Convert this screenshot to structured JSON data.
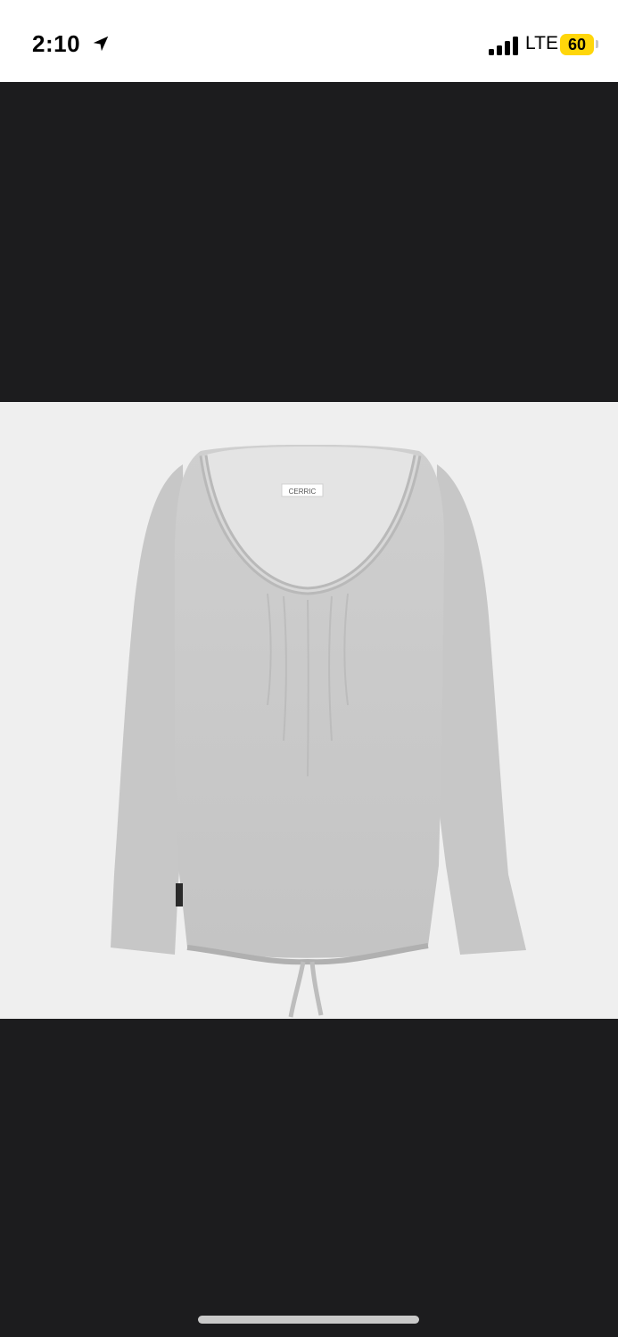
{
  "status_bar": {
    "time": "2:10",
    "location_icon": "location-arrow-icon",
    "signal_icon": "cellular-signal-icon",
    "network": "LTE",
    "battery_level": "60",
    "battery_color": "#ffd60a"
  },
  "viewer": {
    "background": "#1c1c1e",
    "photo": {
      "background": "#efefef",
      "garment_color": "#c9c9c9",
      "neck_label": "CERRIC"
    }
  }
}
